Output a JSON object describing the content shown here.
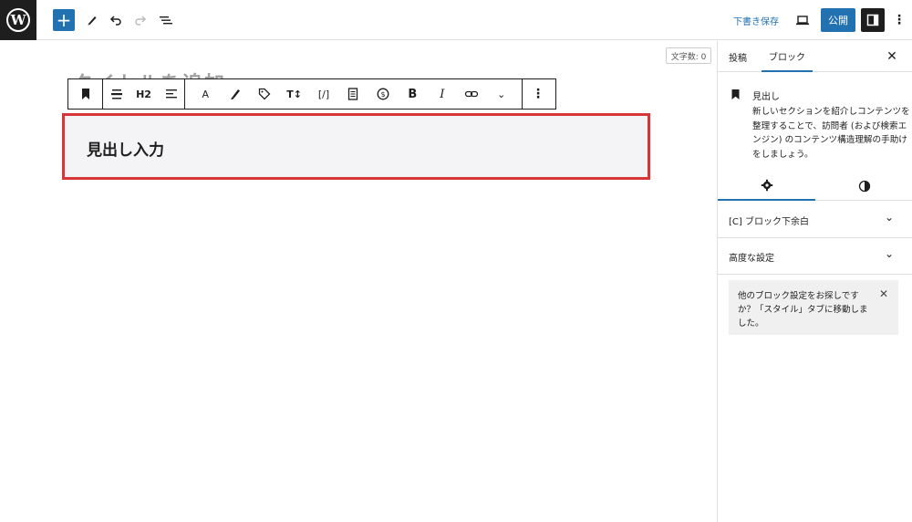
{
  "topbar": {
    "logo_letter": "W",
    "add_label": "+",
    "draft_label": "下書き保存",
    "publish_label": "公開"
  },
  "canvas": {
    "word_count": "文字数: 0",
    "title_placeholder": "タイトルを追加",
    "heading_level": "H2",
    "heading_text": "見出し入力"
  },
  "sidebar": {
    "tabs": [
      "投稿",
      "ブロック"
    ],
    "block_title": "見出し",
    "block_description": "新しいセクションを紹介しコンテンツを整理することで、訪問者 (および検索エンジン) のコンテンツ構造理解の手助けをしましょう。",
    "panels": [
      "[C] ブロック下余白",
      "高度な設定"
    ],
    "notice": "他のブロック設定をお探しですか？「スタイル」タブに移動しました。"
  },
  "colors": {
    "accent": "#2271b1",
    "highlight_border": "#d63638",
    "dark": "#1e1e1e"
  }
}
